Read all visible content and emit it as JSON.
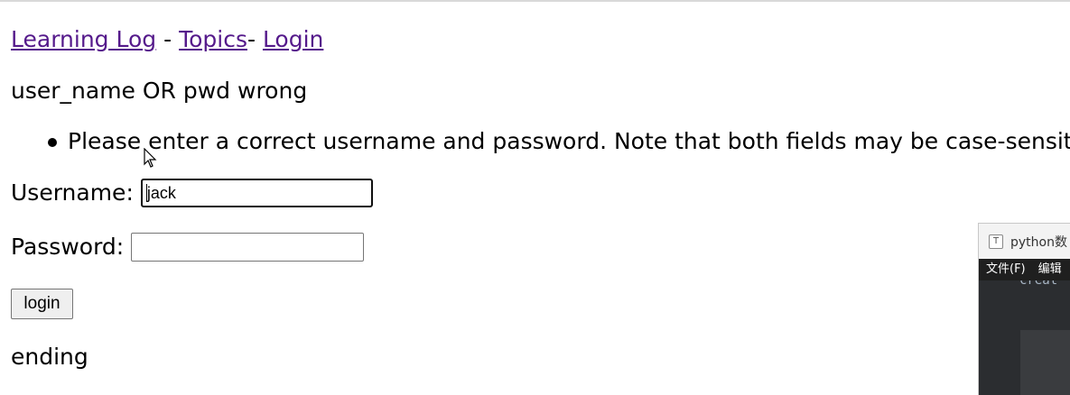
{
  "nav": {
    "home_label": "Learning Log",
    "sep1": " - ",
    "topics_label": "Topics",
    "sep2": "- ",
    "login_label": "Login"
  },
  "message": "user_name OR pwd wrong",
  "errors": [
    "Please enter a correct username and password. Note that both fields may be case-sensitive."
  ],
  "form": {
    "username_label": "Username:",
    "username_value": "jack",
    "password_label": "Password:",
    "password_value": "",
    "submit_label": "login"
  },
  "footer_text": "ending",
  "overlay_window": {
    "title": "python数",
    "app_icon": "T",
    "menu": [
      "文件(F)",
      "编辑"
    ],
    "code_fragment": "creat"
  },
  "colors": {
    "link": "#551a8b",
    "text": "#000000",
    "focus_border": "#101010"
  }
}
